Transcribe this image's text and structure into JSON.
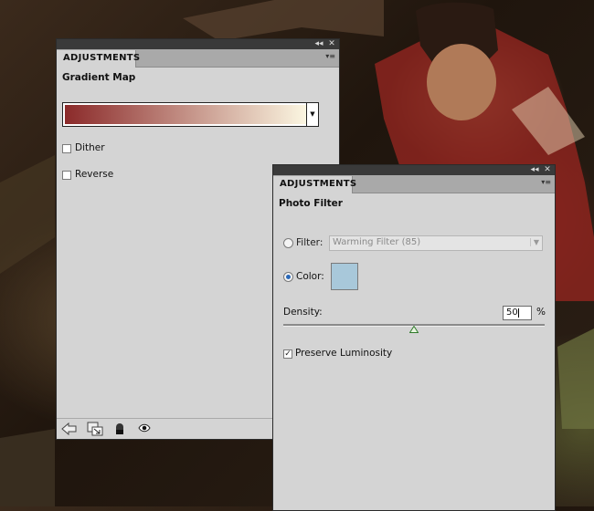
{
  "gradient_panel": {
    "tab_label": "ADJUSTMENTS",
    "title": "Gradient Map",
    "gradient_start_color": "#8b2a2a",
    "gradient_end_color": "#fbf6e1",
    "options": [
      {
        "label": "Dither",
        "checked": false
      },
      {
        "label": "Reverse",
        "checked": false
      }
    ],
    "footer_icons": [
      "back-arrow-icon",
      "clip-layer-icon",
      "mask-icon",
      "visibility-eye-icon",
      "refresh-icon"
    ]
  },
  "photo_panel": {
    "tab_label": "ADJUSTMENTS",
    "title": "Photo Filter",
    "filter_label": "Filter:",
    "filter_value": "Warming Filter (85)",
    "filter_selected": false,
    "color_label": "Color:",
    "color_selected": true,
    "color_swatch": "#a8c8da",
    "density_label": "Density:",
    "density_value": "50",
    "density_unit": "%",
    "density_fraction": 0.5,
    "preserve_label": "Preserve Luminosity",
    "preserve_checked": true
  }
}
